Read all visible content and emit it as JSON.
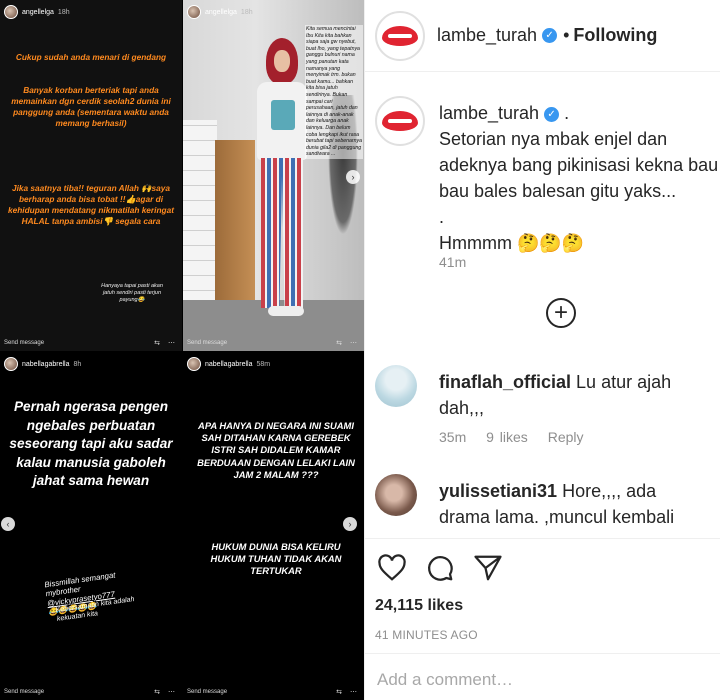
{
  "stories": [
    {
      "username": "angellelga",
      "time": "18h",
      "text_a": "Cukup sudah anda menari di gendang",
      "text_b": "Banyak korban berteriak tapi anda memainkan dgn cerdik seolah2 dunia ini panggung anda (sementara waktu anda memang berhasil)",
      "text_c": "Jika saatnya tiba!! teguran Allah 🙌saya berharap anda bisa tobat !!👍agar di kehidupan mendatang nikmatilah keringat HALAL tanpa ambisi👎 segala cara",
      "text_d": "Hanyaya tapai pasti akan jatuh sendiri pasti terjun payung😂",
      "send": "Send message"
    },
    {
      "username": "angellelga",
      "time": "18h",
      "overlay": "Kita semua mencintai Ibu Kita kita bahkan siapa saja gw nyebut, buat lho, yang tepatnya ganggu bulnuri nama yang panutan kata namanya yang menyimak trm. bukan buat kamu... bahkan kita bisa jatuh sendirinya. Bukan sampai cari perusahaan, jatuh dan lainnya di anak-anak dan keluarga anak lainnya. Dan belum coba lengkapi ikut rasa berubat tapi sebenarnya dunia gila2 di panggung sandiwara ...",
      "send": "Send message"
    },
    {
      "username": "nabellagabrella",
      "time": "8h",
      "text_a": "Pernah ngerasa pengen ngebales perbuatan seseorang tapi aku sadar kalau manusia gaboleh jahat sama hewan",
      "text_b1": "Bissmillah semangat mybrother",
      "text_b2": "@vickyprasetyo777",
      "text_b3": "😂😂😂😂😂",
      "text_c": "Kebersamaan kita adalah kekuatan kita",
      "send": "Send message"
    },
    {
      "username": "nabellagabrella",
      "time": "58m",
      "text_a": "APA HANYA DI NEGARA INI SUAMI SAH DITAHAN KARNA GEREBEK ISTRI SAH DIDALEM KAMAR BERDUAAN DENGAN LELAKI LAIN JAM 2 MALAM ???",
      "text_b": "HUKUM DUNIA BISA KELIRU HUKUM TUHAN TIDAK AKAN TERTUKAR",
      "send": "Send message"
    }
  ],
  "post": {
    "username": "lambe_turah",
    "following": "Following",
    "dot": "•",
    "caption_user": "lambe_turah",
    "caption_line": " .",
    "caption_text": "Setorian nya mbak enjel dan adeknya bang pikinisasi kekna bau bau bales balesan gitu yaks...",
    "caption_dot": ".",
    "caption_hmm": "Hmmmm 🤔🤔🤔",
    "caption_time": "41m",
    "load_more": "+",
    "comments": [
      {
        "user": "finaflah_official",
        "text": "Lu atur ajah dah,,,",
        "time": "35m",
        "likes": "9 likes",
        "reply": "Reply"
      },
      {
        "user": "yulissetiani31",
        "text": "Hore,,,, ada drama lama. ,muncul kembali",
        "time": "",
        "likes": "",
        "reply": ""
      }
    ],
    "like_count": "24,115 likes",
    "time_ago": "41 MINUTES AGO",
    "add_comment_placeholder": "Add a comment…",
    "verified_symbol": "✓"
  },
  "colors": {
    "accent_orange": "#ff8a1f",
    "verified_blue": "#3897f0",
    "logo_red": "#e02431"
  }
}
